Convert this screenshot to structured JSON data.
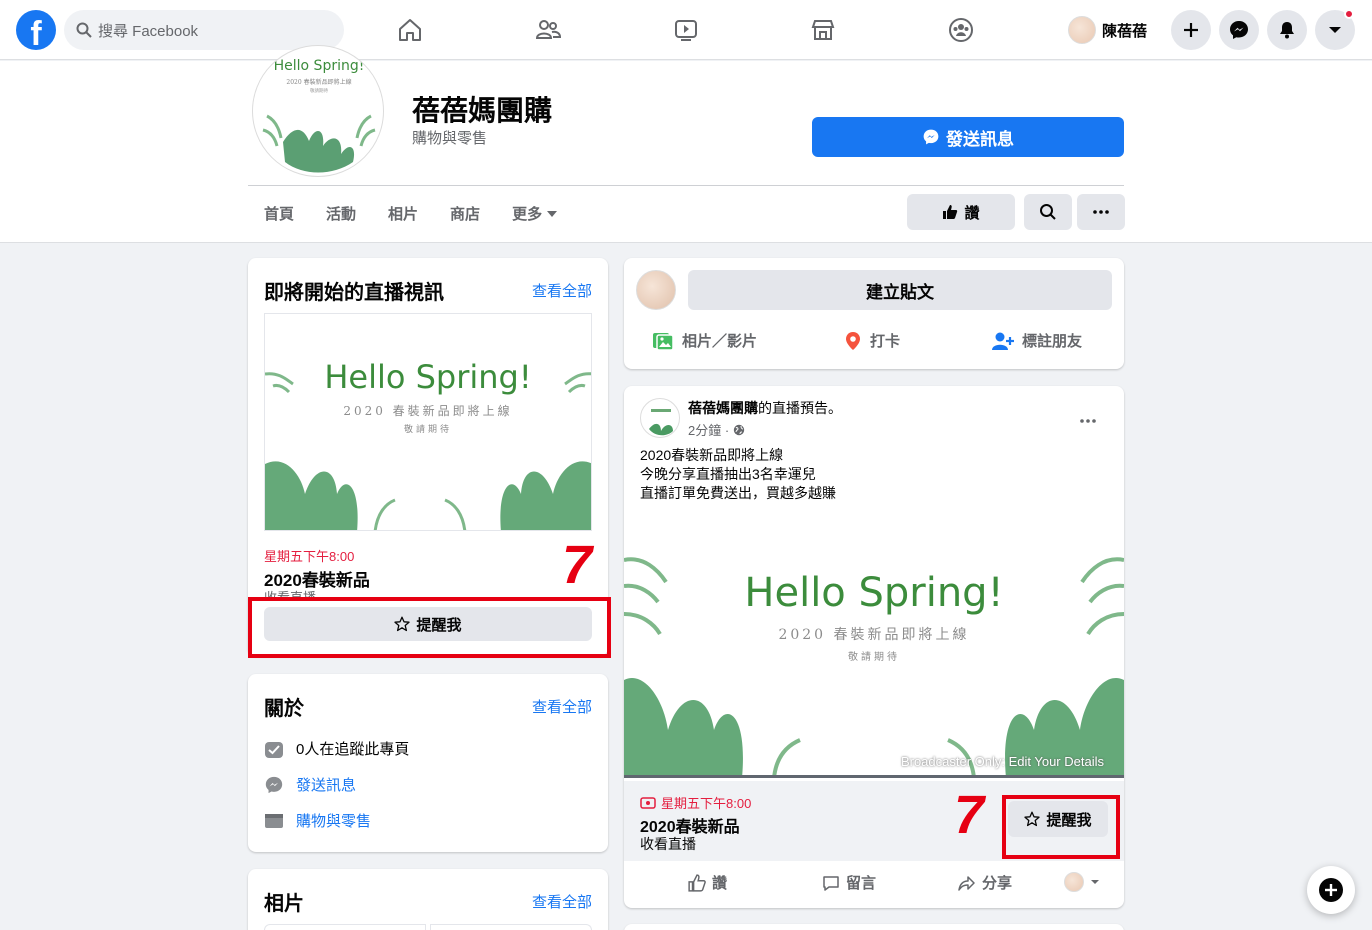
{
  "topbar": {
    "search_placeholder": "搜尋 Facebook",
    "user_name": "陳蓓蓓",
    "logo_letter": "f"
  },
  "page": {
    "title": "蓓蓓媽團購",
    "category": "購物與零售",
    "send_message": "發送訊息",
    "like": "讚",
    "tabs": [
      "首頁",
      "活動",
      "相片",
      "商店",
      "更多"
    ]
  },
  "banner": {
    "headline": "Hello Spring!",
    "sub": "2020 春裝新品即將上線",
    "sub2": "敬請期待",
    "overlay": "Broadcaster Only: Edit Your Details"
  },
  "upcoming": {
    "title": "即將開始的直播視訊",
    "see_all": "查看全部",
    "time": "星期五下午8:00",
    "event_title": "2020春裝新品",
    "event_sub": "收看直播",
    "remind": "提醒我",
    "marker": "7"
  },
  "about": {
    "title": "關於",
    "see_all": "查看全部",
    "followers": "0人在追蹤此專頁",
    "message": "發送訊息",
    "category": "購物與零售"
  },
  "photos": {
    "title": "相片",
    "see_all": "查看全部"
  },
  "composer": {
    "create_post": "建立貼文",
    "photo_video": "相片／影片",
    "check_in": "打卡",
    "tag_friends": "標註朋友"
  },
  "post": {
    "author": "蓓蓓媽團購",
    "action": "的直播預告。",
    "time": "2分鐘 ·",
    "lines": [
      "2020春裝新品即將上線",
      "今晚分享直播抽出3名幸運兒",
      "直播訂單免費送出，買越多越賺"
    ],
    "live_time": "星期五下午8:00",
    "event_title": "2020春裝新品",
    "event_sub": "收看直播",
    "remind": "提醒我",
    "marker": "7",
    "like": "讚",
    "comment": "留言",
    "share": "分享"
  },
  "colors": {
    "brand": "#1877f2",
    "highlight": "#e60012",
    "live": "#e41e3f"
  }
}
